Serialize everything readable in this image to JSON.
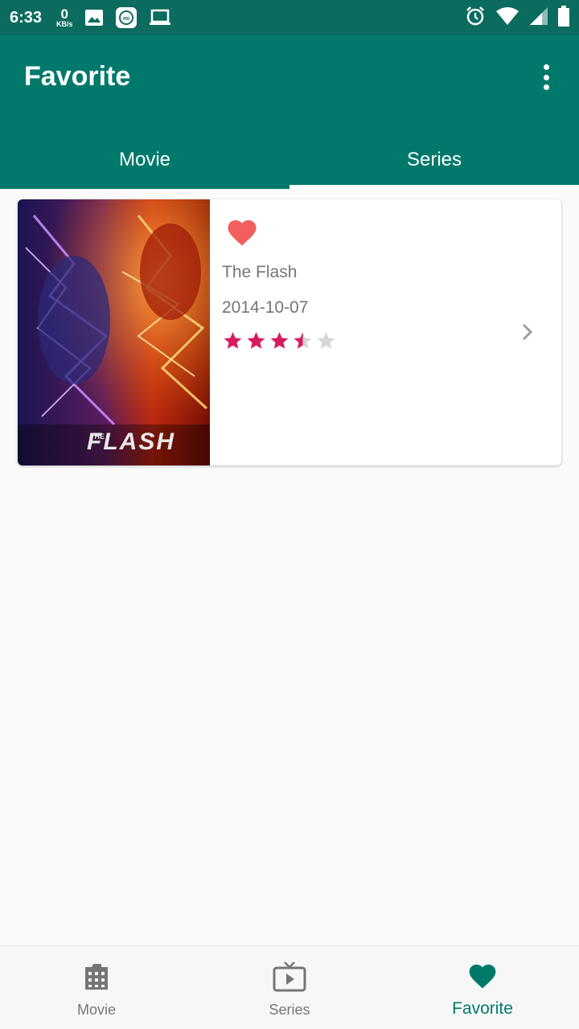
{
  "status_bar": {
    "time": "6:33",
    "net_speed_value": "0",
    "net_speed_unit": "KB/s",
    "icons": [
      "image-icon",
      "mi-app-icon",
      "laptop-icon",
      "alarm-icon",
      "wifi-icon",
      "signal-icon",
      "battery-icon"
    ]
  },
  "app_bar": {
    "title": "Favorite",
    "menu_icon": "more-vert-icon"
  },
  "tabs": [
    {
      "label": "Movie",
      "active": false
    },
    {
      "label": "Series",
      "active": true
    }
  ],
  "favorites": [
    {
      "title": "The Flash",
      "date": "2014-10-07",
      "rating_stars": 3.5,
      "rating_max": 5,
      "poster_text": "FLASH",
      "poster_small_text": "THE",
      "favorite_icon": "heart-icon",
      "action_icon": "chevron-right-icon"
    }
  ],
  "bottom_nav": [
    {
      "label": "Movie",
      "icon": "movie-icon",
      "active": false
    },
    {
      "label": "Series",
      "icon": "tv-icon",
      "active": false
    },
    {
      "label": "Favorite",
      "icon": "heart-icon",
      "active": true
    }
  ],
  "colors": {
    "primary": "#00796b",
    "status_bar": "#0b6b5f",
    "heart": "#f25f5c",
    "star_filled": "#d81b60",
    "star_empty": "#d6d6d6",
    "nav_active": "#00796b"
  }
}
